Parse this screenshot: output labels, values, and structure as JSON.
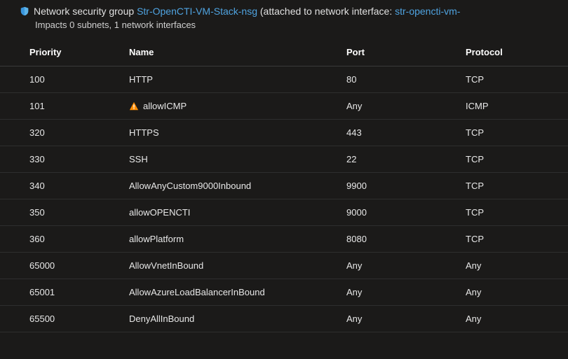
{
  "header": {
    "prefix": "Network security group",
    "nsg_link": "Str-OpenCTI-VM-Stack-nsg",
    "paren_open": "(attached to network interface:",
    "nic_link": "str-opencti-vm-",
    "impacts": "Impacts 0 subnets, 1 network interfaces"
  },
  "columns": {
    "priority": "Priority",
    "name": "Name",
    "port": "Port",
    "protocol": "Protocol"
  },
  "rules": [
    {
      "priority": "100",
      "name": "HTTP",
      "port": "80",
      "protocol": "TCP",
      "warn": false
    },
    {
      "priority": "101",
      "name": "allowICMP",
      "port": "Any",
      "protocol": "ICMP",
      "warn": true
    },
    {
      "priority": "320",
      "name": "HTTPS",
      "port": "443",
      "protocol": "TCP",
      "warn": false
    },
    {
      "priority": "330",
      "name": "SSH",
      "port": "22",
      "protocol": "TCP",
      "warn": false
    },
    {
      "priority": "340",
      "name": "AllowAnyCustom9000Inbound",
      "port": "9900",
      "protocol": "TCP",
      "warn": false
    },
    {
      "priority": "350",
      "name": "allowOPENCTI",
      "port": "9000",
      "protocol": "TCP",
      "warn": false
    },
    {
      "priority": "360",
      "name": "allowPlatform",
      "port": "8080",
      "protocol": "TCP",
      "warn": false
    },
    {
      "priority": "65000",
      "name": "AllowVnetInBound",
      "port": "Any",
      "protocol": "Any",
      "warn": false
    },
    {
      "priority": "65001",
      "name": "AllowAzureLoadBalancerInBound",
      "port": "Any",
      "protocol": "Any",
      "warn": false
    },
    {
      "priority": "65500",
      "name": "DenyAllInBound",
      "port": "Any",
      "protocol": "Any",
      "warn": false
    }
  ]
}
